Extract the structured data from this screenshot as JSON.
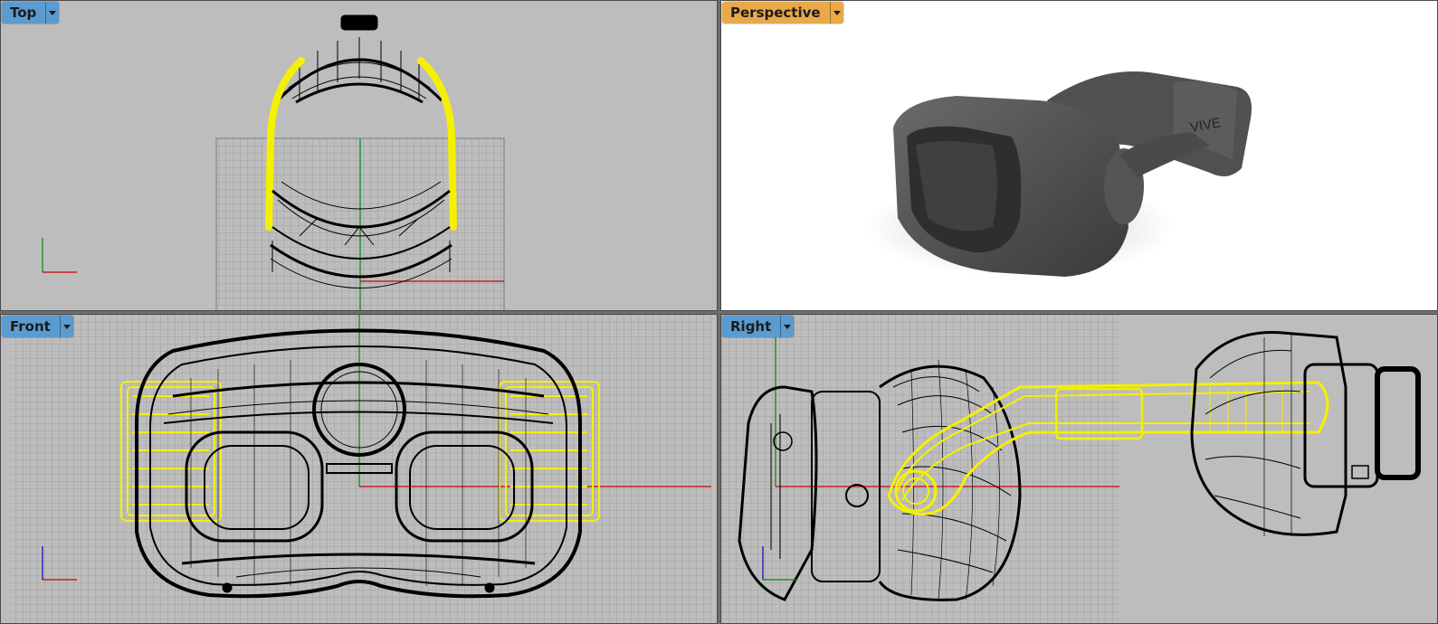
{
  "viewports": {
    "top": {
      "label": "Top",
      "active": false
    },
    "perspective": {
      "label": "Perspective",
      "active": true
    },
    "front": {
      "label": "Front",
      "active": false
    },
    "right": {
      "label": "Right",
      "active": false
    }
  },
  "model": {
    "brand_text": "VIVE"
  },
  "colors": {
    "viewport_bg": "#bdbdbd",
    "grid_line": "#8a8a8a",
    "wire": "#000000",
    "selected_wire": "#f5f000",
    "x_axis": "#cc0000",
    "y_axis": "#008800",
    "tab_inactive": "#5b9bd0",
    "tab_active": "#e9a94a"
  }
}
